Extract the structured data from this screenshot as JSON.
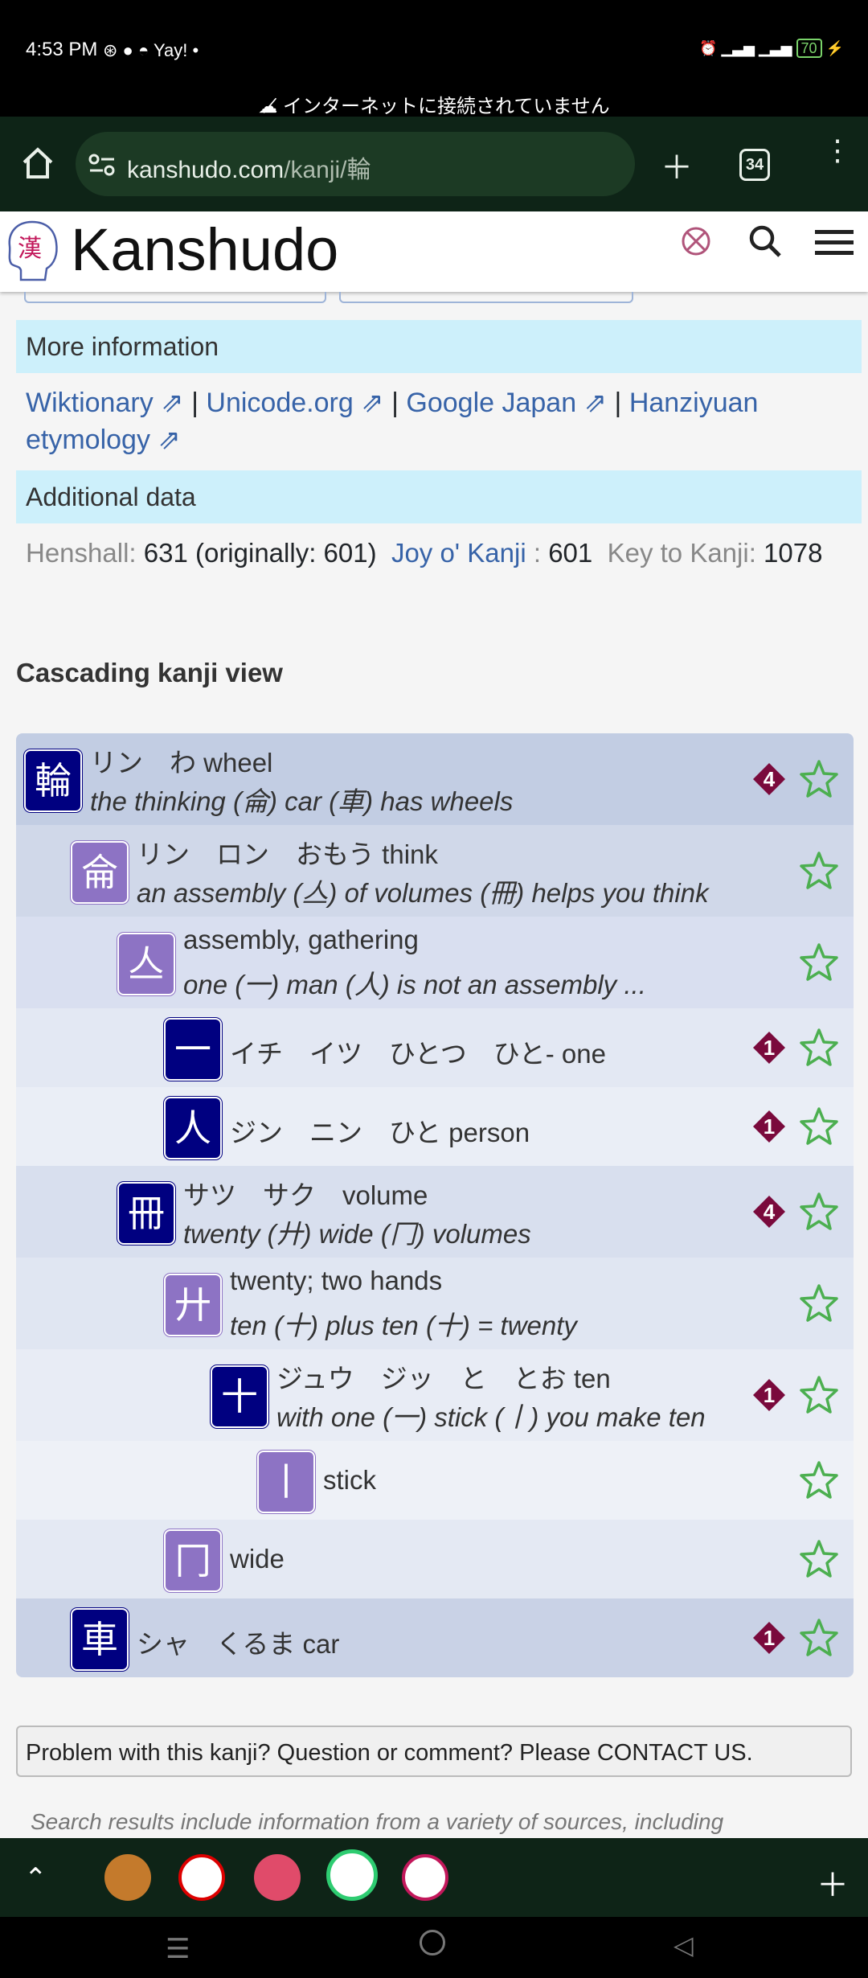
{
  "status": {
    "time": "4:53 PM",
    "offline_message": "インターネットに接続されていません",
    "battery": "70"
  },
  "browser": {
    "url_host": "kanshudo.com",
    "url_path": "/kanji/輪",
    "tab_count": "34"
  },
  "site": {
    "logo_kanji": "漢",
    "name": "Kanshudo"
  },
  "more_info": {
    "heading": "More information",
    "links": [
      "Wiktionary ⇗",
      "Unicode.org ⇗",
      "Google Japan ⇗",
      "Hanziyuan etymology ⇗"
    ],
    "separator": "|"
  },
  "additional": {
    "heading": "Additional data",
    "henshall_label": "Henshall:",
    "henshall_value": "631 (originally: 601)",
    "joy_label": "Joy o' Kanji",
    "joy_sep": ":",
    "joy_value": "601",
    "key_label": "Key to Kanji:",
    "key_value": "1078"
  },
  "cascade": {
    "heading": "Cascading kanji view",
    "rows": [
      {
        "kanji": "輪",
        "line1": "リン　わ wheel",
        "line2": "the thinking (侖) car (車) has wheels",
        "badge": "4",
        "style": "blue"
      },
      {
        "kanji": "侖",
        "line1": "リン　ロン　おもう think",
        "line2": "an assembly (亼) of volumes (冊) helps you think",
        "badge": "",
        "style": "purple"
      },
      {
        "kanji": "亼",
        "line1": "assembly, gathering",
        "line2": "one (一) man (人) is not an assembly ...",
        "badge": "",
        "style": "purple"
      },
      {
        "kanji": "一",
        "line1": "イチ　イツ　ひとつ　ひと- one",
        "line2": "",
        "badge": "1",
        "style": "blue"
      },
      {
        "kanji": "人",
        "line1": "ジン　ニン　ひと person",
        "line2": "",
        "badge": "1",
        "style": "blue"
      },
      {
        "kanji": "冊",
        "line1": "サツ　サク　volume",
        "line2": "twenty (廾) wide (冂) volumes",
        "badge": "4",
        "style": "blue"
      },
      {
        "kanji": "廾",
        "line1": "twenty; two hands",
        "line2": "ten (十) plus ten (十) = twenty",
        "badge": "",
        "style": "purple"
      },
      {
        "kanji": "十",
        "line1": "ジュウ　ジッ　と　とお ten",
        "line2": "with one (一) stick (丨) you make ten",
        "badge": "1",
        "style": "blue"
      },
      {
        "kanji": "丨",
        "line1": "stick",
        "line2": "",
        "badge": "",
        "style": "purple"
      },
      {
        "kanji": "冂",
        "line1": "wide",
        "line2": "",
        "badge": "",
        "style": "purple"
      },
      {
        "kanji": "車",
        "line1": "シャ　くるま car",
        "line2": "",
        "badge": "1",
        "style": "blue"
      }
    ]
  },
  "contact_text": "Problem with this kanji? Question or comment? Please CONTACT US.",
  "footnote": "Search results include information from a variety of sources, including",
  "colors": {
    "accent_blue": "#000080",
    "accent_purple": "#8d73c4",
    "badge": "#7a0a3c",
    "star": "#4caf50",
    "info_bg": "#cdf0fb"
  }
}
